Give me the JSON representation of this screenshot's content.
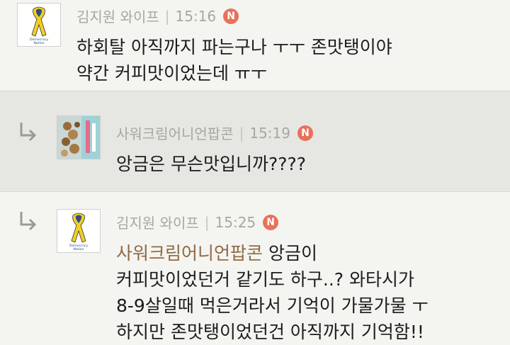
{
  "comments": [
    {
      "author": "김지원 와이프",
      "time": "15:16",
      "badge": "N",
      "lines": [
        "하회탈 아직까지 파는구나 ㅜㅜ 존맛탱이야",
        "약간 커피맛이었는데 ㅠㅜ"
      ]
    },
    {
      "author": "사워크림어니언팝콘",
      "time": "15:19",
      "badge": "N",
      "lines": [
        "앙금은 무슨맛입니까????"
      ]
    },
    {
      "author": "김지원 와이프",
      "time": "15:25",
      "badge": "N",
      "mention": "사워크림어니언팝콘",
      "first_line_rest": " 앙금이",
      "lines": [
        "커피맛이었던거 같기도 하구..? 와타시가",
        "8-9살일때 먹은거라서 기억이 가물가물 ㅜ",
        "하지만 존맛탱이었던건 아직까지 기억함!!"
      ]
    }
  ],
  "avatar_ribbon": {
    "caption": [
      "Democracy",
      "Nation"
    ],
    "colors": {
      "ribbon_yellow": "#f3cf22",
      "ribbon_blue": "#2e4f86",
      "ribbon_black": "#222222"
    }
  },
  "colors": {
    "background": "#f4f4f1",
    "highlight_background": "#e6e6e3",
    "meta_text": "#a6a6a3",
    "badge": "#e8715a",
    "mention": "#8f6a43"
  }
}
